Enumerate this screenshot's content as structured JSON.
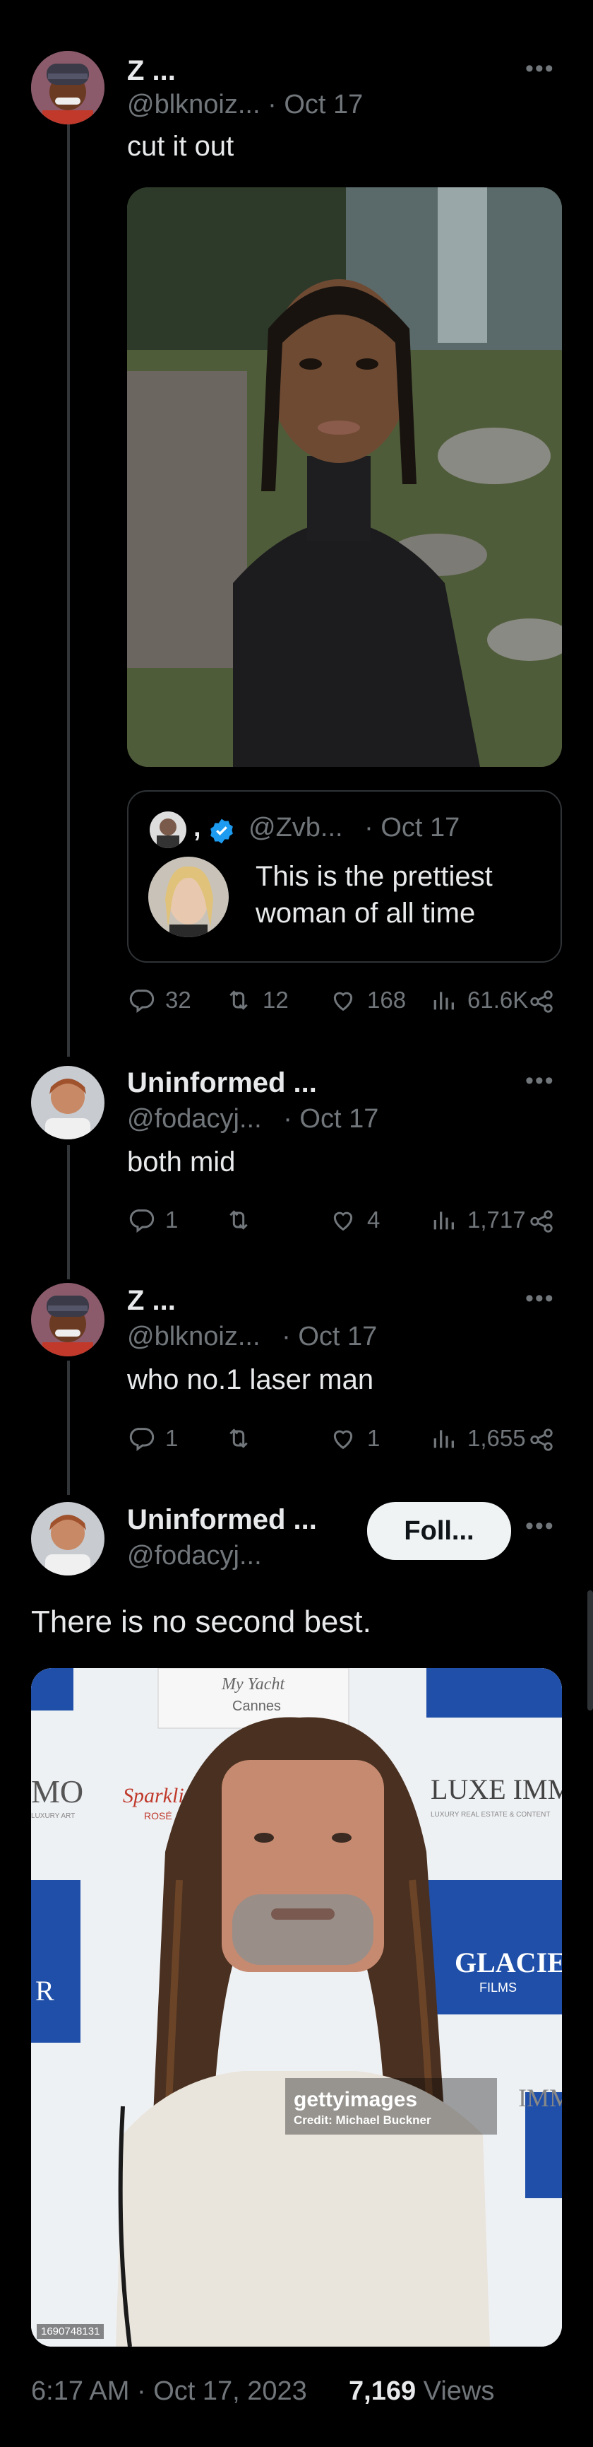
{
  "tweets": [
    {
      "name": "Z ...",
      "handle": "@blknoiz...",
      "date": "· Oct 17",
      "text": "cut it out",
      "quote": {
        "name_prefix": ",",
        "handle": "@Zvb...",
        "date": "· Oct 17",
        "text_line1": "This is the prettiest",
        "text_line2": "woman of all time"
      },
      "stats": {
        "replies": "32",
        "reposts": "12",
        "likes": "168",
        "views": "61.6K"
      }
    },
    {
      "name": "Uninformed ...",
      "handle": "@fodacyj...",
      "date": "· Oct 17",
      "text": "both mid",
      "stats": {
        "replies": "1",
        "reposts": "",
        "likes": "4",
        "views": "1,717"
      }
    },
    {
      "name": "Z ...",
      "handle": "@blknoiz...",
      "date": "· Oct 17",
      "text": "who no.1 laser man",
      "stats": {
        "replies": "1",
        "reposts": "",
        "likes": "1",
        "views": "1,655"
      }
    }
  ],
  "main_tweet": {
    "name": "Uninformed ...",
    "handle": "@fodacyj...",
    "follow_label": "Foll...",
    "text": "There is no second best.",
    "image": {
      "backdrop_words": [
        "My Yacht",
        "Cannes",
        "LUXE IMM",
        "LUXURY REAL ESTATE & CONTENT",
        "GLACIER",
        "FILMS",
        "Sparkling",
        "ROSÉ",
        "MO",
        "LUXURY ART",
        "R",
        "IMM"
      ],
      "watermark": "gettyimages",
      "credit": "Credit: Michael Buckner",
      "image_id": "1690748131"
    },
    "timestamp": "6:17 AM · Oct 17, 2023",
    "views_count": "7,169",
    "views_label": "Views"
  },
  "colors": {
    "background": "#000000",
    "text": "#e7e9ea",
    "muted": "#71767b",
    "border": "#2f3336",
    "verified": "#1d9bf0"
  },
  "icons": [
    "more-icon",
    "verified-icon",
    "reply-icon",
    "repost-icon",
    "like-icon",
    "views-icon",
    "share-icon"
  ]
}
